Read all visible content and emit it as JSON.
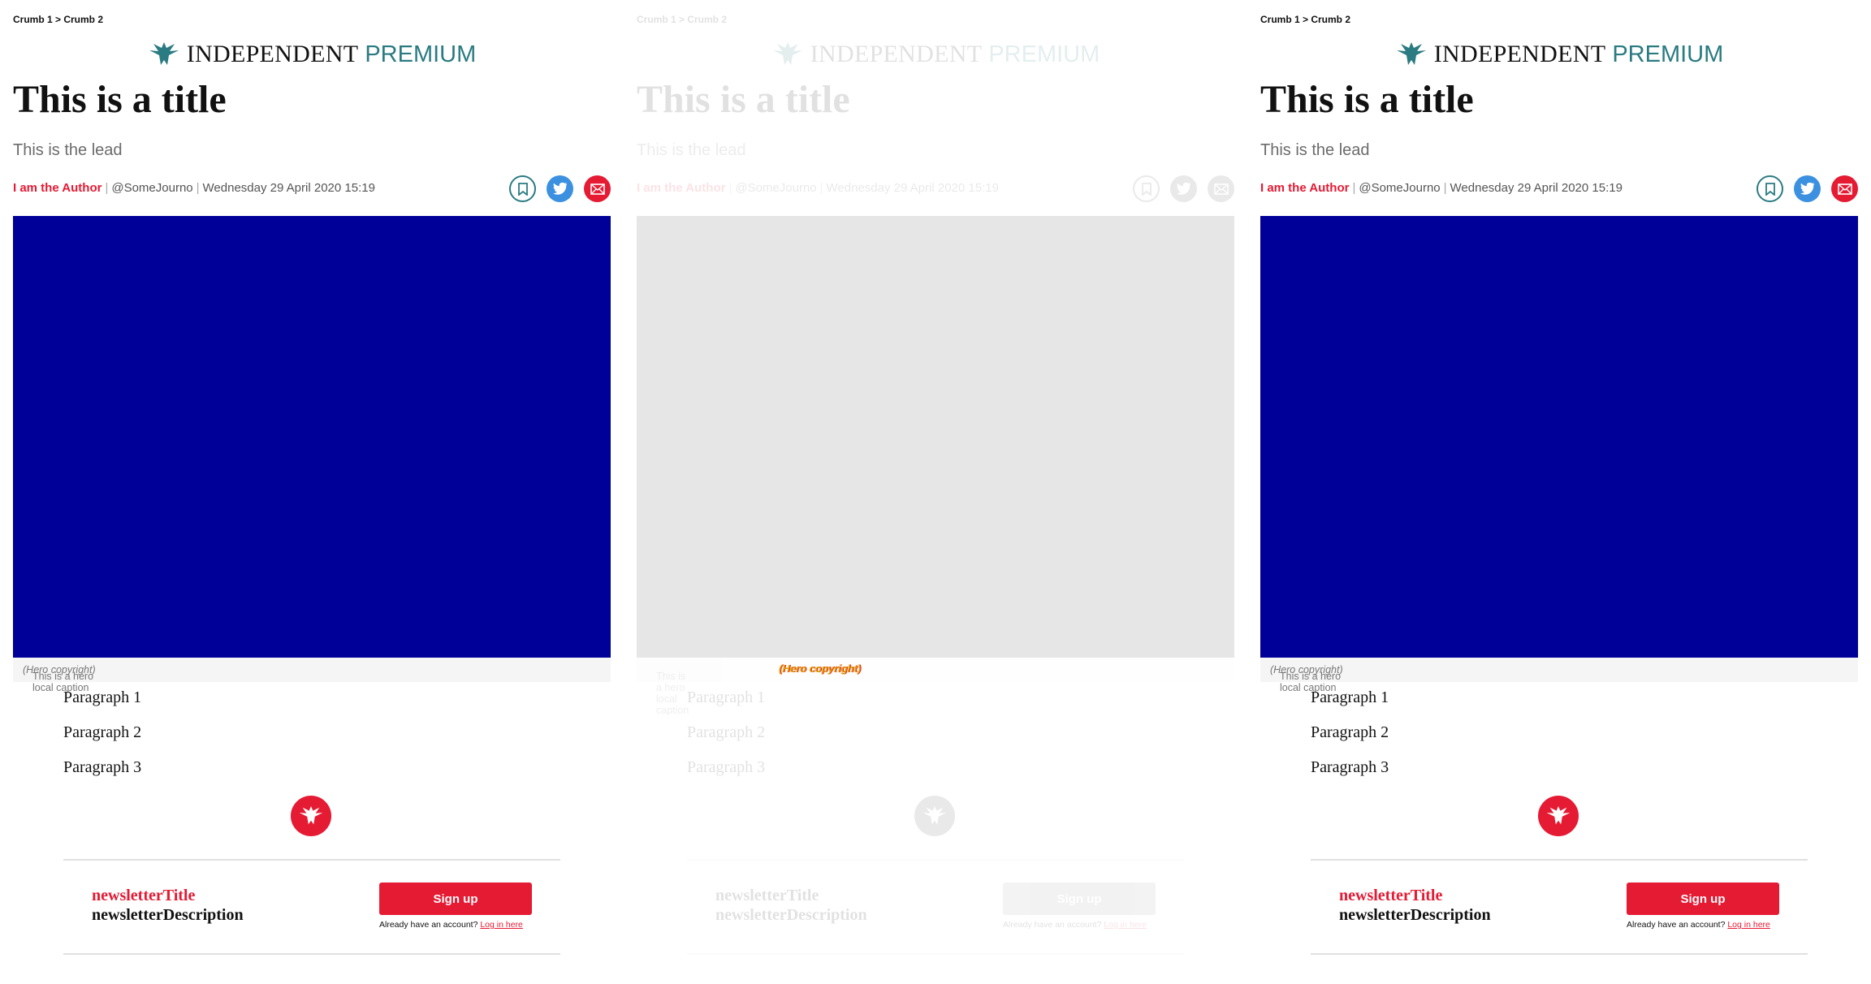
{
  "breadcrumbs": {
    "text": "Crumb 1 > Crumb 2"
  },
  "brand": {
    "name": "INDEPENDENT",
    "premium": "PREMIUM"
  },
  "article": {
    "title": "This is a title",
    "lead": "This is the lead",
    "author": "I am the Author",
    "handle": "@SomeJourno",
    "date": "Wednesday 29 April 2020 15:19",
    "hero_caption": "This is a hero local caption",
    "hero_copyright": "(Hero copyright)",
    "paragraphs": [
      "Paragraph 1",
      "Paragraph 2",
      "Paragraph 3"
    ]
  },
  "newsletter": {
    "title": "newsletterTitle",
    "description": "newsletterDescription",
    "signup_label": "Sign up",
    "already": "Already have an account?",
    "login_link": "Log in here"
  },
  "colors": {
    "accent": "#e51a33",
    "brand_teal": "#2a7b82",
    "hero": "#000099",
    "twitter": "#3b90e0"
  },
  "icons": [
    "bookmark-icon",
    "twitter-icon",
    "email-icon",
    "eagle-logo-icon"
  ]
}
